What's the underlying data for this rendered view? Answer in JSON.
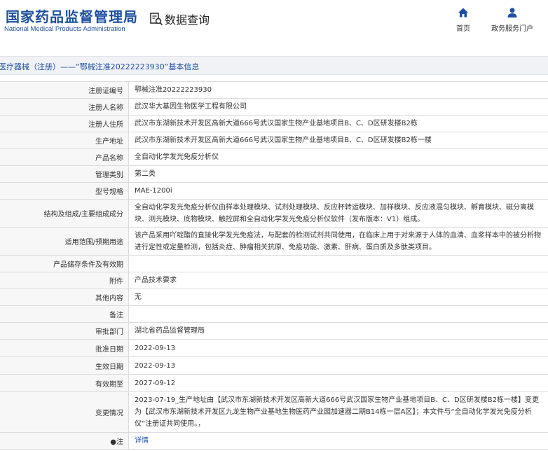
{
  "header": {
    "logo_cn": "国家药品监督管理局",
    "logo_en": "National Medical Products Administration",
    "query_label": "数据查询",
    "query_icon": "search-document-icon",
    "nav": [
      {
        "label": "首页",
        "icon": "home-icon"
      },
      {
        "label": "政务服务门户",
        "icon": "user-icon"
      }
    ]
  },
  "breadcrumb": "医疗器械（注册）——“鄂械注准20222223930”基本信息",
  "rows": [
    {
      "label": "注册证编号",
      "value": "鄂械注准20222223930"
    },
    {
      "label": "注册人名称",
      "value": "武汉华大基因生物医学工程有限公司"
    },
    {
      "label": "注册人住所",
      "value": "武汉市东湖新技术开发区高新大道666号武汉国家生物产业基地项目B、C、D区研发楼B2栋"
    },
    {
      "label": "生产地址",
      "value": "武汉市东湖新技术开发区高新大道666号武汉国家生物产业基地项目B、C、D区研发楼B2栋一楼"
    },
    {
      "label": "产品名称",
      "value": "全自动化学发光免疫分析仪"
    },
    {
      "label": "管理类别",
      "value": "第二类"
    },
    {
      "label": "型号规格",
      "value": "MAE-1200i"
    },
    {
      "label": "结构及组成/主要组成成分",
      "value": "全自动化学发光免疫分析仪由样本处理模块、试剂处理模块、反应杯转运模块、加样模块、反应液混匀模块、孵育模块、磁分离模块、测光模块、底物模块、触控屏和全自动化学发光免疫分析仪软件（发布版本：V1）组成。"
    },
    {
      "label": "适用范围/预期用途",
      "value": "该产品采用吖啶酯的直接化学发光免疫法，与配套的检测试剂共同使用，在临床上用于对来源于人体的血清、血浆样本中的被分析物进行定性或定量检测，包括炎症、肿瘤相关抗原、免疫功能、激素、肝病、蛋白质及多肽类项目。"
    },
    {
      "label": "产品储存条件及有效期",
      "value": ""
    },
    {
      "label": "附件",
      "value": "产品技术要求"
    },
    {
      "label": "其他内容",
      "value": "无"
    },
    {
      "label": "备注",
      "value": ""
    },
    {
      "label": "审批部门",
      "value": "湖北省药品监督管理局"
    },
    {
      "label": "批准日期",
      "value": "2022-09-13"
    },
    {
      "label": "生效日期",
      "value": "2022-09-13"
    },
    {
      "label": "有效期至",
      "value": "2027-09-12"
    },
    {
      "label": "变更情况",
      "value": "2023-07-19_生产地址由【武汉市东湖新技术开发区高新大道666号武汉国家生物产业基地项目B、C、D区研发楼B2栋一楼】变更为【武汉市东湖新技术开发区九龙生物产业基地生物医药产业园加速器二期B14栋一层A区】；本文件与“全自动化学发光免疫分析仪”注册证共同使用。，"
    },
    {
      "label": "●注",
      "value": "详情"
    }
  ]
}
